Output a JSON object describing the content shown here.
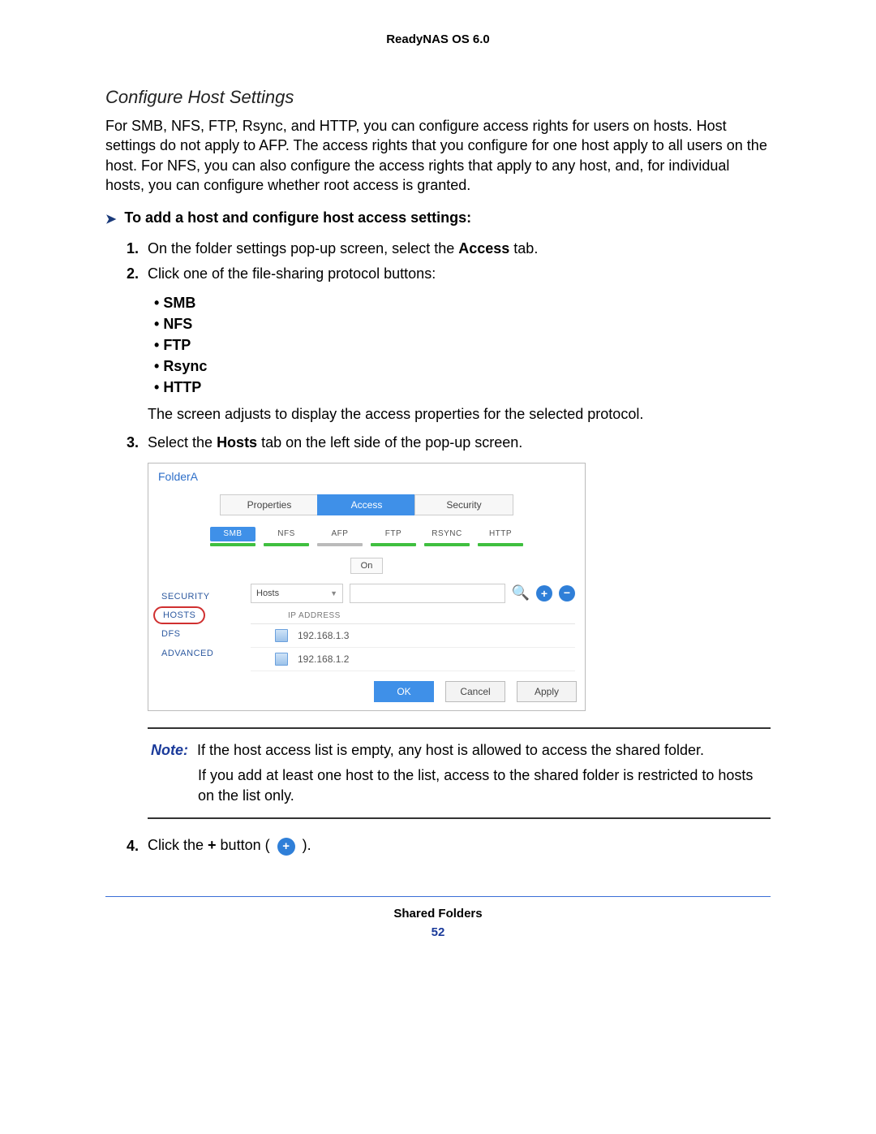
{
  "header": {
    "title": "ReadyNAS OS 6.0"
  },
  "section": {
    "title": "Configure Host Settings",
    "intro": "For SMB, NFS, FTP, Rsync, and HTTP, you can configure access rights for users on hosts. Host settings do not apply to AFP. The access rights that you configure for one host apply to all users on the host. For NFS, you can also configure the access rights that apply to any host, and, for individual hosts, you can configure whether root access is granted."
  },
  "task": {
    "label": "To add a host and configure host access settings:"
  },
  "steps": {
    "s1a": "On the folder settings pop-up screen, select the ",
    "s1b": "Access",
    "s1c": " tab.",
    "s2": "Click one of the file-sharing protocol buttons:",
    "after2": "The screen adjusts to display the access properties for the selected protocol.",
    "s3a": "Select the ",
    "s3b": "Hosts",
    "s3c": " tab on the left side of the pop-up screen.",
    "s4a": "Click the ",
    "s4b": "+",
    "s4c": " button ( ",
    "s4d": " )."
  },
  "bullets": [
    "SMB",
    "NFS",
    "FTP",
    "Rsync",
    "HTTP"
  ],
  "dialog": {
    "title": "FolderA",
    "tabs": [
      "Properties",
      "Access",
      "Security"
    ],
    "protocols": [
      "SMB",
      "NFS",
      "AFP",
      "FTP",
      "RSYNC",
      "HTTP"
    ],
    "on": "On",
    "leftnav": {
      "security": "SECURITY",
      "hosts": "HOSTS",
      "dfs": "DFS",
      "advanced": "ADVANCED"
    },
    "hosts_label": "Hosts",
    "ip_header": "IP ADDRESS",
    "ips": [
      "192.168.1.3",
      "192.168.1.2"
    ],
    "buttons": {
      "ok": "OK",
      "cancel": "Cancel",
      "apply": "Apply"
    }
  },
  "note": {
    "label": "Note:",
    "line1": "If the host access list is empty, any host is allowed to access the shared folder.",
    "line2": "If you add at least one host to the list, access to the shared folder is restricted to hosts on the list only."
  },
  "footer": {
    "section": "Shared Folders",
    "page": "52"
  }
}
